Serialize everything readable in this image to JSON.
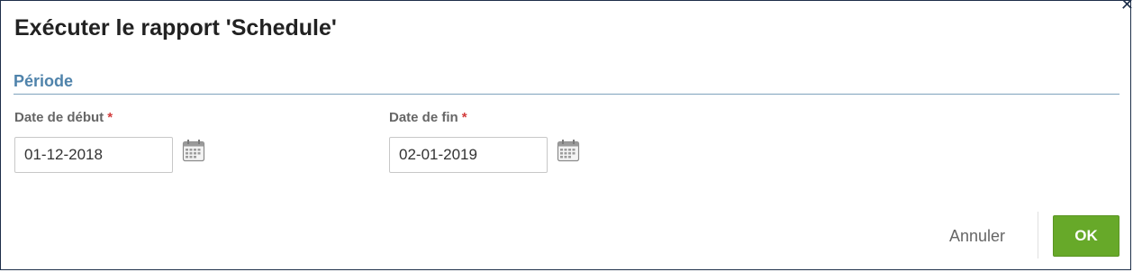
{
  "dialog": {
    "title": "Exécuter le rapport 'Schedule'",
    "close_icon": "close-icon"
  },
  "section": {
    "title": "Période"
  },
  "fields": {
    "start": {
      "label": "Date de début",
      "required_marker": "*",
      "value": "01-12-2018",
      "icon": "calendar-icon"
    },
    "end": {
      "label": "Date de fin",
      "required_marker": "*",
      "value": "02-01-2019",
      "icon": "calendar-icon"
    }
  },
  "footer": {
    "cancel_label": "Annuler",
    "ok_label": "OK"
  },
  "colors": {
    "accent_green": "#67a929",
    "section_blue": "#4f83ab",
    "required_red": "#d33c3c",
    "border_navy": "#1e2f4a"
  }
}
